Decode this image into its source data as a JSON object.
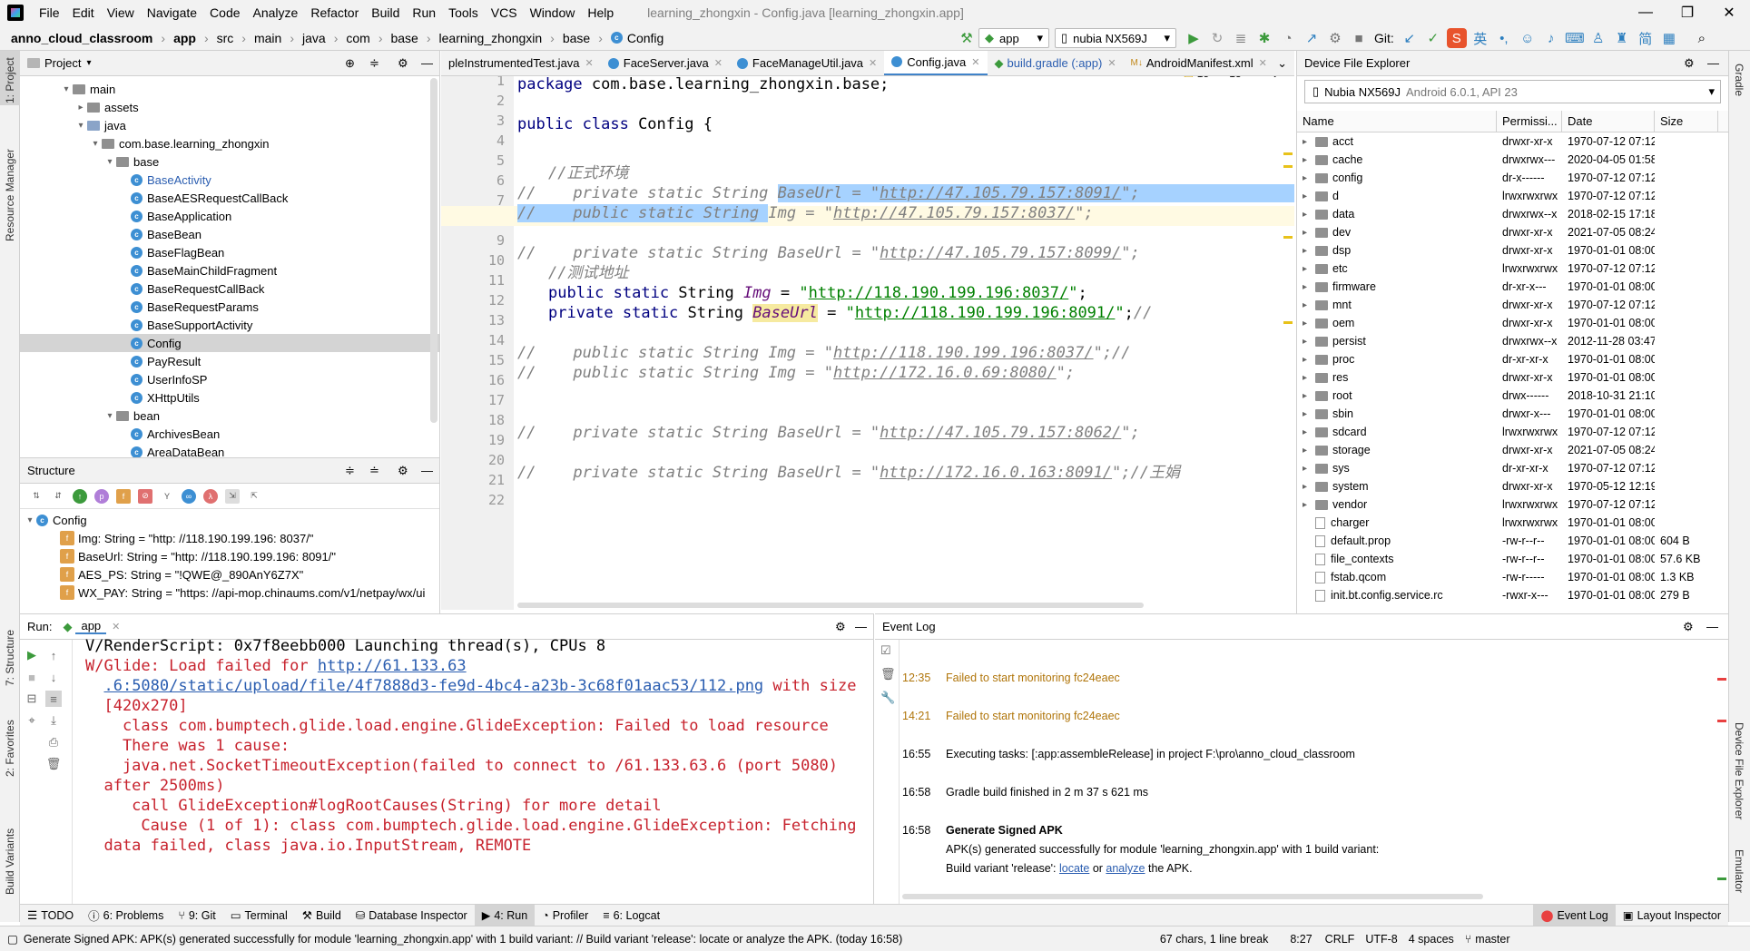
{
  "menubar": {
    "items": [
      "File",
      "Edit",
      "View",
      "Navigate",
      "Code",
      "Analyze",
      "Refactor",
      "Build",
      "Run",
      "Tools",
      "VCS",
      "Window",
      "Help"
    ],
    "title": "learning_zhongxin - Config.java [learning_zhongxin.app]"
  },
  "navbar": {
    "crumbs": [
      "anno_cloud_classroom",
      "app",
      "src",
      "main",
      "java",
      "com",
      "base",
      "learning_zhongxin",
      "base",
      "Config"
    ],
    "run_config": "app",
    "device": "nubia NX569J",
    "git_label": "Git:"
  },
  "project": {
    "title": "Project",
    "tree": [
      {
        "label": "main",
        "depth": 3,
        "type": "folder",
        "arrow": "▾"
      },
      {
        "label": "assets",
        "depth": 4,
        "type": "folder",
        "arrow": "▸"
      },
      {
        "label": "java",
        "depth": 4,
        "type": "folder-blue",
        "arrow": "▾"
      },
      {
        "label": "com.base.learning_zhongxin",
        "depth": 5,
        "type": "folder",
        "arrow": "▾"
      },
      {
        "label": "base",
        "depth": 6,
        "type": "folder",
        "arrow": "▾"
      },
      {
        "label": "BaseActivity",
        "depth": 7,
        "type": "class",
        "color": "#2a5db0"
      },
      {
        "label": "BaseAESRequestCallBack",
        "depth": 7,
        "type": "class"
      },
      {
        "label": "BaseApplication",
        "depth": 7,
        "type": "class"
      },
      {
        "label": "BaseBean",
        "depth": 7,
        "type": "class"
      },
      {
        "label": "BaseFlagBean",
        "depth": 7,
        "type": "class"
      },
      {
        "label": "BaseMainChildFragment",
        "depth": 7,
        "type": "class"
      },
      {
        "label": "BaseRequestCallBack",
        "depth": 7,
        "type": "class"
      },
      {
        "label": "BaseRequestParams",
        "depth": 7,
        "type": "class"
      },
      {
        "label": "BaseSupportActivity",
        "depth": 7,
        "type": "class"
      },
      {
        "label": "Config",
        "depth": 7,
        "type": "class",
        "selected": true
      },
      {
        "label": "PayResult",
        "depth": 7,
        "type": "class"
      },
      {
        "label": "UserInfoSP",
        "depth": 7,
        "type": "class"
      },
      {
        "label": "XHttpUtils",
        "depth": 7,
        "type": "class"
      },
      {
        "label": "bean",
        "depth": 6,
        "type": "folder",
        "arrow": "▾"
      },
      {
        "label": "ArchivesBean",
        "depth": 7,
        "type": "class"
      },
      {
        "label": "AreaDataBean",
        "depth": 7,
        "type": "class"
      }
    ]
  },
  "structure": {
    "title": "Structure",
    "root": "Config",
    "items": [
      "Img: String = \"http: //118.190.199.196: 8037/\"",
      "BaseUrl: String = \"http: //118.190.199.196: 8091/\"",
      "AES_PS: String = \"!QWE@_890AnY6Z7X\"",
      "WX_PAY: String = \"https: //api-mop.chinaums.com/v1/netpay/wx/ui"
    ]
  },
  "editor": {
    "tabs": [
      "pleInstrumentedTest.java",
      "FaceServer.java",
      "FaceManageUtil.java",
      "Config.java",
      "build.gradle (:app)",
      "AndroidManifest.xml"
    ],
    "active_tab": "Config.java",
    "warnings": "15",
    "checks": "13",
    "line_numbers": [
      "1",
      "2",
      "3",
      "4",
      "5",
      "6",
      "7",
      "8",
      "9",
      "10",
      "11",
      "12",
      "13",
      "14",
      "15",
      "16",
      "17",
      "18",
      "19",
      "20",
      "21",
      "22"
    ]
  },
  "device_explorer": {
    "title": "Device File Explorer",
    "device": "Nubia NX569J",
    "device_sub": "Android 6.0.1, API 23",
    "columns": [
      "Name",
      "Permissi...",
      "Date",
      "Size"
    ],
    "rows": [
      [
        "acct",
        "drwxr-xr-x",
        "1970-07-12 07:12",
        ""
      ],
      [
        "cache",
        "drwxrwx---",
        "2020-04-05 01:58",
        ""
      ],
      [
        "config",
        "dr-x------",
        "1970-07-12 07:12",
        ""
      ],
      [
        "d",
        "lrwxrwxrwx",
        "1970-07-12 07:12",
        ""
      ],
      [
        "data",
        "drwxrwx--x",
        "2018-02-15 17:18",
        ""
      ],
      [
        "dev",
        "drwxr-xr-x",
        "2021-07-05 08:24",
        ""
      ],
      [
        "dsp",
        "drwxr-xr-x",
        "1970-01-01 08:00",
        ""
      ],
      [
        "etc",
        "lrwxrwxrwx",
        "1970-07-12 07:12",
        ""
      ],
      [
        "firmware",
        "dr-xr-x---",
        "1970-01-01 08:00",
        ""
      ],
      [
        "mnt",
        "drwxr-xr-x",
        "1970-07-12 07:12",
        ""
      ],
      [
        "oem",
        "drwxr-xr-x",
        "1970-01-01 08:00",
        ""
      ],
      [
        "persist",
        "drwxrwx--x",
        "2012-11-28 03:47",
        ""
      ],
      [
        "proc",
        "dr-xr-xr-x",
        "1970-01-01 08:00",
        ""
      ],
      [
        "res",
        "drwxr-xr-x",
        "1970-01-01 08:00",
        ""
      ],
      [
        "root",
        "drwx------",
        "2018-10-31 21:10",
        ""
      ],
      [
        "sbin",
        "drwxr-x---",
        "1970-01-01 08:00",
        ""
      ],
      [
        "sdcard",
        "lrwxrwxrwx",
        "1970-07-12 07:12",
        ""
      ],
      [
        "storage",
        "drwxr-xr-x",
        "2021-07-05 08:24",
        ""
      ],
      [
        "sys",
        "dr-xr-xr-x",
        "1970-07-12 07:12",
        ""
      ],
      [
        "system",
        "drwxr-xr-x",
        "1970-05-12 12:19",
        ""
      ],
      [
        "vendor",
        "lrwxrwxrwx",
        "1970-07-12 07:12",
        ""
      ],
      [
        "charger",
        "lrwxrwxrwx",
        "1970-01-01 08:00",
        ""
      ],
      [
        "default.prop",
        "-rw-r--r--",
        "1970-01-01 08:00",
        "604 B"
      ],
      [
        "file_contexts",
        "-rw-r--r--",
        "1970-01-01 08:00",
        "57.6 KB"
      ],
      [
        "fstab.qcom",
        "-rw-r-----",
        "1970-01-01 08:00",
        "1.3 KB"
      ],
      [
        "init.bt.config.service.rc",
        "-rwxr-x---",
        "1970-01-01 08:00",
        "279 B"
      ]
    ]
  },
  "run": {
    "title": "Run:",
    "config": "app"
  },
  "eventlog": {
    "title": "Event Log",
    "entries": [
      {
        "time": "12:35",
        "text": "Failed to start monitoring fc24eaec",
        "warn": true
      },
      {
        "time": "14:21",
        "text": "Failed to start monitoring fc24eaec",
        "warn": true
      },
      {
        "time": "16:55",
        "text": "Executing tasks: [:app:assembleRelease] in project F:\\pro\\anno_cloud_classroom",
        "warn": false
      },
      {
        "time": "16:58",
        "text": "Gradle build finished in 2 m 37 s 621 ms",
        "warn": false
      }
    ],
    "apk_time": "16:58",
    "apk_title": "Generate Signed APK",
    "apk_line1": "APK(s) generated successfully for module 'learning_zhongxin.app' with 1 build variant:",
    "apk_line2_pre": "Build variant 'release': ",
    "apk_locate": "locate",
    "apk_or": " or ",
    "apk_analyze": "analyze",
    "apk_line2_post": " the APK."
  },
  "bottom_tools": [
    "TODO",
    "6: Problems",
    "9: Git",
    "Terminal",
    "Build",
    "Database Inspector",
    "4: Run",
    "Profiler",
    "6: Logcat"
  ],
  "bottom_right": [
    "Event Log",
    "Layout Inspector"
  ],
  "status": {
    "message": "Generate Signed APK: APK(s) generated successfully for module 'learning_zhongxin.app' with 1 build variant: // Build variant 'release': locate or analyze the APK. (today 16:58)",
    "chars": "67 chars, 1 line break",
    "pos": "8:27",
    "crlf": "CRLF",
    "enc": "UTF-8",
    "indent": "4 spaces",
    "branch": "master"
  },
  "stripes": {
    "left": [
      "1: Project",
      "Resource Manager",
      "7: Structure",
      "2: Favorites",
      "Build Variants"
    ],
    "right": [
      "Gradle",
      "Device File Explorer",
      "Emulator"
    ]
  }
}
